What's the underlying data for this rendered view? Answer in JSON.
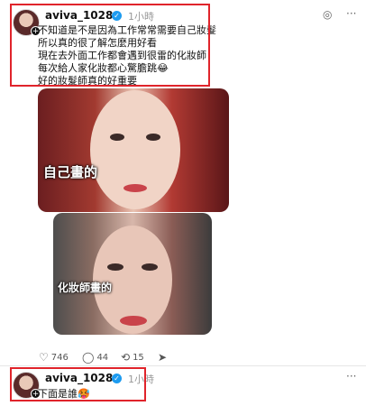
{
  "post1": {
    "username": "aviva_1028",
    "time": "1小時",
    "lines": [
      "不知道是不是因為工作常常需要自己妝髮",
      "所以真的很了解怎麼用好看",
      "現在去外面工作都會遇到很雷的化妝師",
      "每次給人家化妝都心驚膽跳😂",
      "好的妝髮師真的好重要"
    ],
    "image1_label": "自己畫的",
    "image2_label": "化妝師畫的",
    "likes": "746",
    "comments": "44",
    "reposts": "15"
  },
  "post2": {
    "username": "aviva_1028",
    "time": "1小時",
    "text": "下面是誰🥵"
  },
  "icons": {
    "verified": "verified-badge-icon",
    "like": "heart-icon",
    "comment": "comment-icon",
    "repost": "repost-icon",
    "share": "share-icon",
    "more": "more-icon",
    "translate": "translate-icon"
  },
  "colors": {
    "highlight": "#e0242b",
    "verified": "#1d9bf0"
  }
}
